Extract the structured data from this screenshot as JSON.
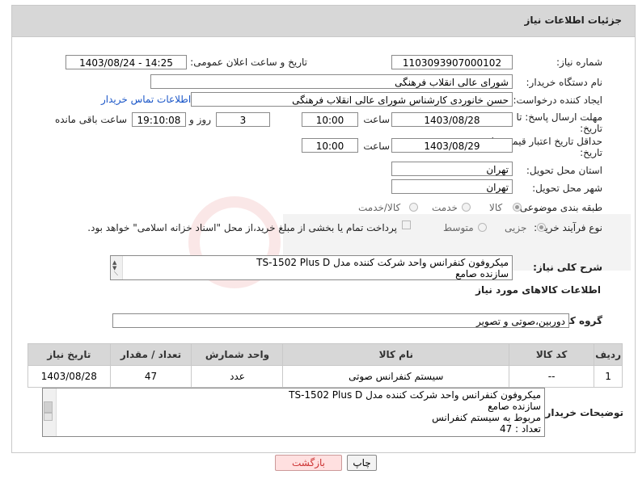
{
  "header": {
    "title": "جزئیات اطلاعات نیاز"
  },
  "form": {
    "need_number_label": "شماره نیاز:",
    "need_number": "1103093907000102",
    "announce_label": "تاریخ و ساعت اعلان عمومی:",
    "announce_value": "1403/08/24 - 14:25",
    "buyer_org_label": "نام دستگاه خریدار:",
    "buyer_org": "شورای عالی انقلاب فرهنگی",
    "requester_label": "ایجاد کننده درخواست:",
    "requester": "حسن خانوردی کارشناس شورای عالی انقلاب فرهنگی",
    "contact_link": "اطلاعات تماس خریدار",
    "reply_deadline_label": "مهلت ارسال پاسخ: تا",
    "reply_deadline_label2": "تاریخ:",
    "reply_date": "1403/08/28",
    "time_label": "ساعت",
    "reply_time": "10:00",
    "days_value": "3",
    "days_label": "روز و",
    "remaining_time": "19:10:08",
    "remaining_label": "ساعت باقی مانده",
    "price_validity_label": "حداقل تاریخ اعتبار قیمت: تا",
    "price_validity_label2": "تاریخ:",
    "price_date": "1403/08/29",
    "price_time_label": "ساعت",
    "price_time": "10:00",
    "province_label": "استان محل تحویل:",
    "province": "تهران",
    "city_label": "شهر محل تحویل:",
    "city": "تهران",
    "category_label": "طبقه بندی موضوعی:",
    "category_options": [
      "کالا",
      "خدمت",
      "کالا/خدمت"
    ],
    "process_label": "نوع فرآیند خرید :",
    "process_options": [
      "جزیی",
      "متوسط"
    ],
    "payment_note": "پرداخت تمام یا بخشی از مبلغ خرید،از محل \"اسناد خزانه اسلامی\" خواهد بود.",
    "summary_label": "شرح کلی نیاز:",
    "summary_lines": [
      "میکروفون کنفرانس واحد شرکت کننده مدل TS-1502 Plus D",
      "سازنده صامع"
    ]
  },
  "goods": {
    "section_title": "اطلاعات کالاهای مورد نیاز",
    "group_label": "گروه کالا:",
    "group_value": "دوربین،صوتی و تصویر",
    "columns": [
      "ردیف",
      "کد کالا",
      "نام کالا",
      "واحد شمارش",
      "تعداد / مقدار",
      "تاریخ نیاز"
    ],
    "rows": [
      [
        "1",
        "--",
        "سیستم کنفرانس صوتی",
        "عدد",
        "47",
        "1403/08/28"
      ]
    ]
  },
  "buyer_notes": {
    "label": "توضیحات خریدار:",
    "lines": [
      "میکروفون کنفرانس واحد شرکت کننده مدل TS-1502 Plus D",
      "سازنده صامع",
      "مربوط به سیستم کنفرانس",
      "تعداد : 47"
    ]
  },
  "buttons": {
    "print": "چاپ",
    "back": "بازگشت"
  },
  "colors": {
    "header_bg": "#d7d7d7",
    "link": "#1a56c8",
    "back_btn": "#ffe0e0"
  }
}
